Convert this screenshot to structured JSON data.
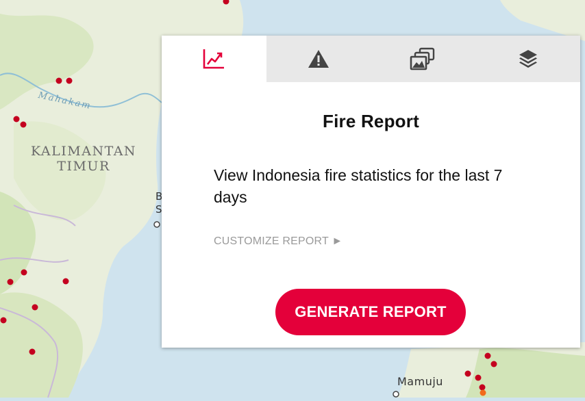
{
  "map": {
    "region_label_line1": "KALIMANTAN",
    "region_label_line2": "TIMUR",
    "river_label": "Mahakam",
    "city_label": "Mamuju",
    "partial_label": "B",
    "partial_label_2": "S",
    "colors": {
      "land": "#e9eedc",
      "land_green": "#cfe2b4",
      "water": "#cfe3ee",
      "fire_dot": "#c4001f",
      "fire_dot_orange": "#f26a1b"
    }
  },
  "panel": {
    "tabs": [
      {
        "name": "analysis",
        "icon": "line-chart-icon",
        "active": true
      },
      {
        "name": "alerts",
        "icon": "warning-triangle-icon",
        "active": false
      },
      {
        "name": "imagery",
        "icon": "image-stack-icon",
        "active": false
      },
      {
        "name": "layers",
        "icon": "layers-icon",
        "active": false
      }
    ],
    "title": "Fire Report",
    "description": "View Indonesia fire statistics for the last 7 days",
    "customize_label": "CUSTOMIZE REPORT ►",
    "button_label": "GENERATE REPORT",
    "colors": {
      "accent": "#e4003a",
      "tab_bg": "#e8e8e8",
      "muted": "#9a9a9a"
    }
  }
}
